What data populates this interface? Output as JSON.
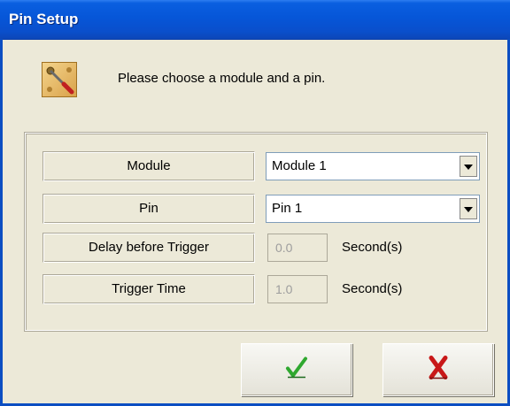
{
  "window": {
    "title": "Pin Setup"
  },
  "instruction": "Please choose a module and a pin.",
  "form": {
    "module_label": "Module",
    "module_value": "Module 1",
    "pin_label": "Pin",
    "pin_value": "Pin 1",
    "delay_label": "Delay before Trigger",
    "delay_value": "0.0",
    "delay_unit": "Second(s)",
    "trigger_label": "Trigger Time",
    "trigger_value": "1.0",
    "trigger_unit": "Second(s)"
  },
  "icons": {
    "header": "screwdriver-tool-icon",
    "ok": "green-check-icon",
    "cancel": "red-x-icon"
  },
  "colors": {
    "title_bar": "#0656d8",
    "dialog_bg": "#ECE9D8",
    "ok_icon": "#2fa82f",
    "cancel_icon": "#c81818"
  }
}
